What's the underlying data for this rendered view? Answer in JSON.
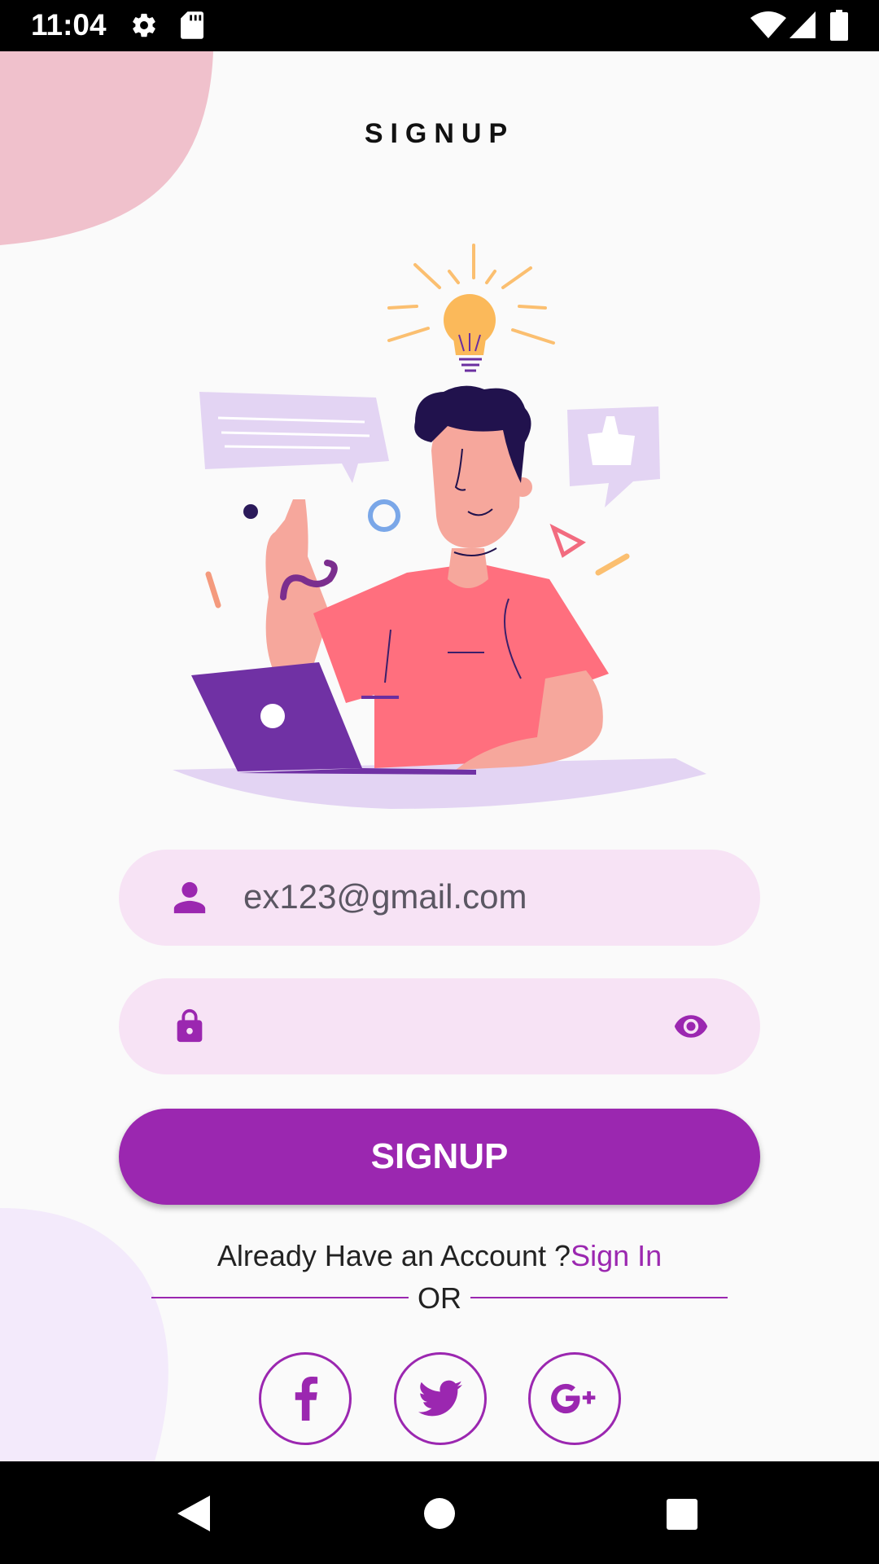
{
  "status_bar": {
    "time": "11:04",
    "icons": [
      "settings-icon",
      "sd-card-icon",
      "wifi-icon",
      "signal-icon",
      "battery-icon"
    ]
  },
  "page": {
    "title": "SIGNUP",
    "illustration": "man-with-laptop-and-lightbulb"
  },
  "form": {
    "email_value": "ex123@gmail.com",
    "email_icon": "person-icon",
    "password_value": "",
    "password_icon": "lock-icon",
    "password_toggle_icon": "eye-icon",
    "submit_label": "SIGNUP"
  },
  "footer": {
    "account_prompt": "Already Have an Account ?",
    "signin_label": "Sign In",
    "divider_text": "OR",
    "social": [
      "facebook-icon",
      "twitter-icon",
      "google-plus-icon"
    ]
  },
  "colors": {
    "accent": "#9B27B0",
    "field_bg": "#F7E3F5",
    "blob_pink": "#F0C1CC",
    "blob_lavender": "#F3EAFB"
  },
  "nav_bar": {
    "icons": [
      "back-icon",
      "home-icon",
      "recents-icon"
    ]
  }
}
